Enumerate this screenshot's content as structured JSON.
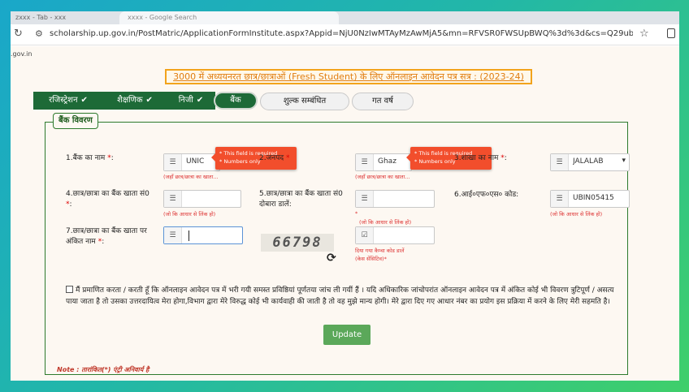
{
  "browser": {
    "tab1": "zxxx - Tab - xxx",
    "tab2": "xxxx - Google Search",
    "url": "scholarship.up.gov.in/PostMatric/ApplicationFormInstitute.aspx?Appid=NjU0NzIwMTAyMzAwMjA5&mn=RFVSR0FWSUpBWQ%3d%3d&cs=Q29ubmVjdEN1cnJlbnRGWU..."
  },
  "page": {
    "domain_fragment": ".gov.in",
    "heading": "3000 में अध्ययनरत छात्र/छात्राओं (Fresh Student) के लिए ऑनलाइन आवेदन पत्र सत्र : (2023-24)",
    "tabs": [
      {
        "label": "रजिस्ट्रेशन",
        "tick": "✔"
      },
      {
        "label": "शैक्षणिक",
        "tick": "✔"
      },
      {
        "label": "निजी",
        "tick": "✔"
      },
      {
        "label": "बैंक"
      },
      {
        "label": "शुल्क सम्बंधित"
      },
      {
        "label": "गत वर्ष"
      }
    ],
    "section_title": "बैंक विवरण",
    "fields": {
      "bank_name_label": "1.बैंक का नाम",
      "bank_name_value": "UNIC",
      "bank_name_hint": "(जहाँ छात्र/छात्रा का खाता...",
      "district_label": "2.जनपद",
      "district_value": "Ghaz",
      "district_hint": "(जहाँ छात्र/छात्रा का खाता...",
      "branch_label": "3.शाखा का नाम",
      "branch_value": "JALALAB",
      "account_label": "4.छात्र/छात्रा का बैंक खाता सं0",
      "account_hint": "(जो कि आधार से लिंक हो)",
      "account_confirm_label": "5.छात्र/छात्रा का बैंक खाता सं0 दोबारा डालें:",
      "account_confirm_hint": "(जो कि आधार से लिंक हो)",
      "ifsc_label": "6.आई०एफ०एस० कोड:",
      "ifsc_value": "UBIN05415",
      "ifsc_hint": "(जो कि आधार से लिंक हो)",
      "holder_label": "7.छात्र/छात्रा का बैंक खाता पर अंकित नाम",
      "required_star": "*",
      "captcha_text": "66798",
      "captcha_hint_1": "दिया गया कैप्चा कोड डालें",
      "captcha_hint_2": "(केस सेंसिटिव)"
    },
    "tooltip": {
      "line1": "* This field is required",
      "line2": "* Numbers only"
    },
    "declaration": "मैं प्रमाणित करता / करती हूँ कि ऑनलाइन आवेदन पत्र में भरी गयी समस्त प्रविष्ठियां पूर्णतया जांच ली गयीं हैं । यदि अधिकारिक जांचोपरांत ऑनलाइन आवेदन पत्र में अंकित कोई भी विवरण त्रुटिपूर्ण / असत्य पाया जाता है तो उसका उत्तरदायित्व मेरा होगा,विभाग द्वारा मेरे विरुद्ध कोई भी कार्यवाही की जाती है तो वह मुझे मान्य होगी। मेरे द्वारा दिए गए आधार नंबर का प्रयोग इस प्रक्रिया में करने के लिए मेरी सहमति है।",
    "update_button": "Update",
    "note": "Note : तारांकित(*) एंट्री अनिवार्य है"
  },
  "colors": {
    "tab_done": "#1d6a37",
    "tooltip": "#f24e2c",
    "heading_border": "#f2a31c",
    "update_button": "#5ba85a"
  }
}
